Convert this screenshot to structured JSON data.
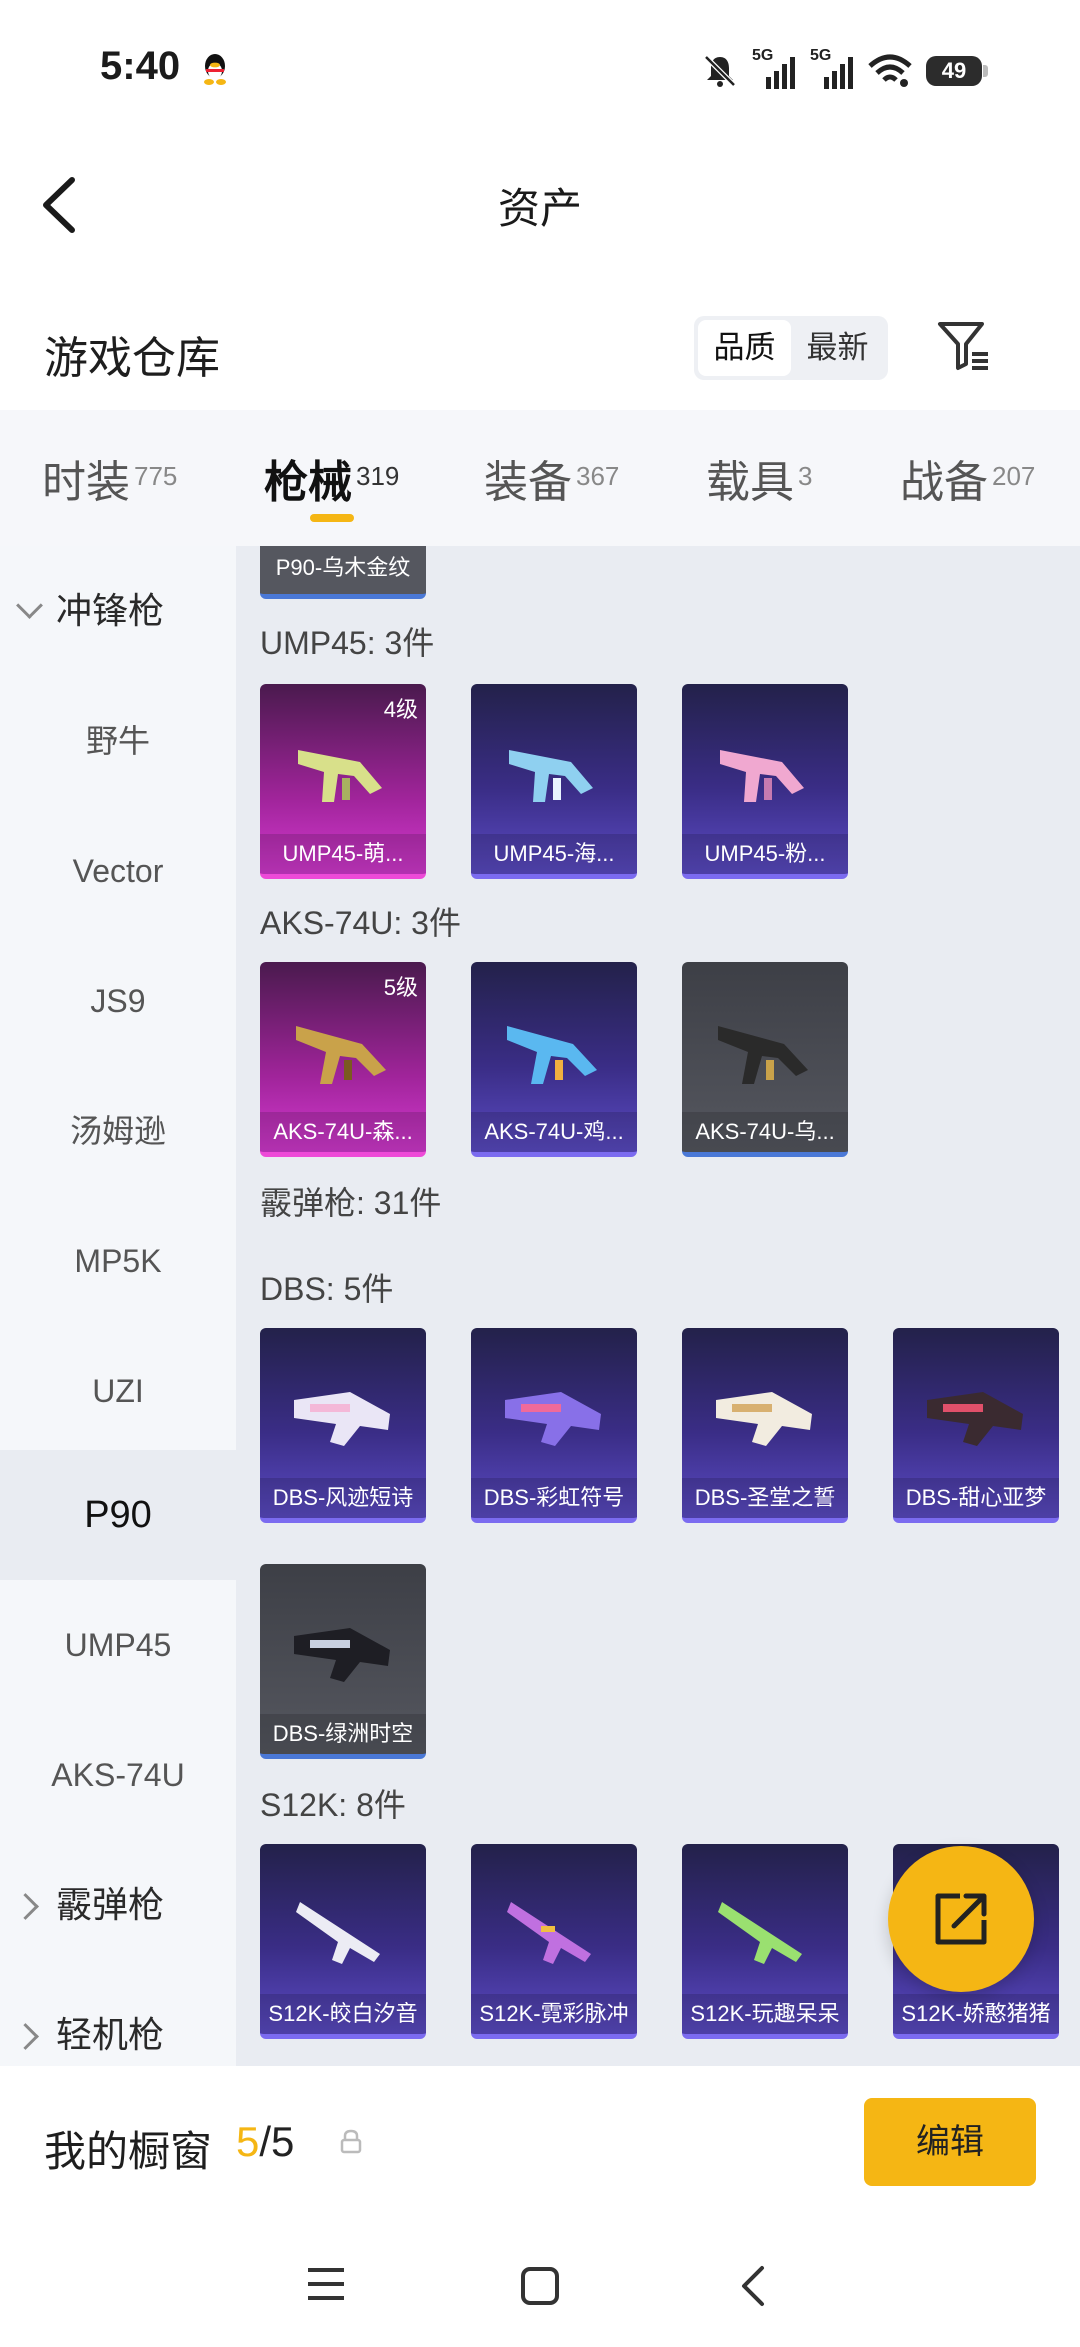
{
  "status": {
    "time": "5:40",
    "battery": "49",
    "signal1": "5G",
    "signal2": "5G"
  },
  "header": {
    "title": "资产"
  },
  "warehouse": {
    "title": "游戏仓库",
    "sort_options": [
      "品质",
      "最新"
    ]
  },
  "tabs": [
    {
      "label": "时装",
      "count": "775"
    },
    {
      "label": "枪械",
      "count": "319"
    },
    {
      "label": "装备",
      "count": "367"
    },
    {
      "label": "载具",
      "count": "3"
    },
    {
      "label": "战备",
      "count": "207"
    }
  ],
  "sidebar": {
    "items": [
      "冲锋枪",
      "野牛",
      "Vector",
      "JS9",
      "汤姆逊",
      "MP5K",
      "UZI",
      "P90",
      "UMP45",
      "AKS-74U",
      "霰弹枪",
      "轻机枪"
    ]
  },
  "main": {
    "partial_card": "P90-乌木金纹",
    "sections": [
      {
        "title": "UMP45: 3件",
        "cards": [
          {
            "label": "UMP45-萌...",
            "level": "4级"
          },
          {
            "label": "UMP45-海..."
          },
          {
            "label": "UMP45-粉..."
          }
        ]
      },
      {
        "title": "AKS-74U: 3件",
        "cards": [
          {
            "label": "AKS-74U-森...",
            "level": "5级"
          },
          {
            "label": "AKS-74U-鸡..."
          },
          {
            "label": "AKS-74U-乌..."
          }
        ]
      },
      {
        "title": "霰弹枪: 31件"
      },
      {
        "title": "DBS: 5件",
        "cards": [
          {
            "label": "DBS-风迹短诗"
          },
          {
            "label": "DBS-彩虹符号"
          },
          {
            "label": "DBS-圣堂之誓"
          },
          {
            "label": "DBS-甜心亚梦"
          },
          {
            "label": "DBS-绿洲时空"
          }
        ]
      },
      {
        "title": "S12K: 8件",
        "cards": [
          {
            "label": "S12K-皎白汐音"
          },
          {
            "label": "S12K-霓彩脉冲"
          },
          {
            "label": "S12K-玩趣呆呆"
          },
          {
            "label": "S12K-娇憨猪猪"
          }
        ]
      }
    ]
  },
  "showcase": {
    "label": "我的橱窗",
    "count": "5",
    "total": "/5",
    "edit": "编辑"
  },
  "colors": {
    "accent": "#f5b614",
    "purple_card": "#3a2d86",
    "pink_card": "#a0249a",
    "grey_card": "#55575f"
  }
}
